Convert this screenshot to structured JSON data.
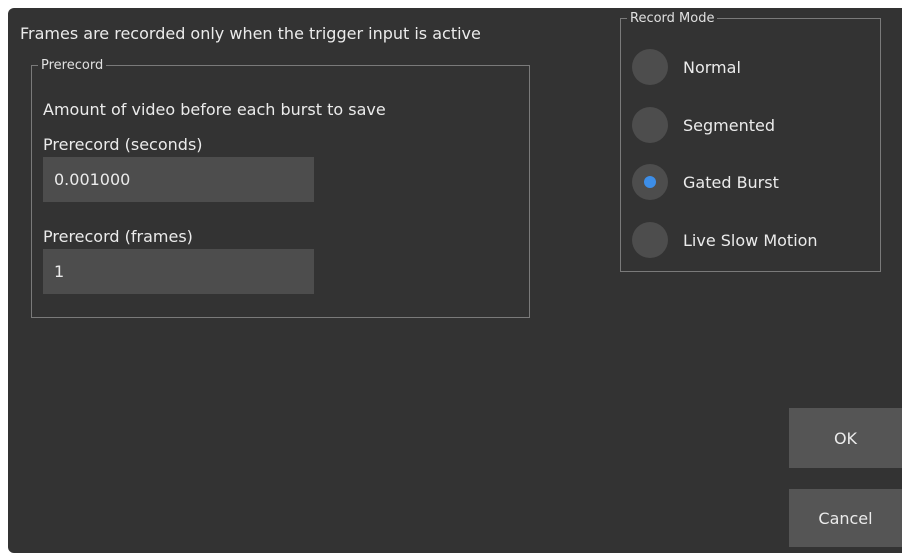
{
  "dialog": {
    "description": "Frames are recorded only when the trigger input is active"
  },
  "prerecord": {
    "group_title": "Prerecord",
    "description": "Amount of video before each burst to save",
    "seconds_label": "Prerecord (seconds)",
    "seconds_value": "0.001000",
    "frames_label": "Prerecord (frames)",
    "frames_value": "1"
  },
  "record_mode": {
    "group_title": "Record Mode",
    "options": [
      {
        "label": "Normal",
        "selected": false
      },
      {
        "label": "Segmented",
        "selected": false
      },
      {
        "label": "Gated Burst",
        "selected": true
      },
      {
        "label": "Live Slow Motion",
        "selected": false
      }
    ]
  },
  "buttons": {
    "ok_label": "OK",
    "cancel_label": "Cancel"
  },
  "colors": {
    "background": "#333333",
    "field": "#4d4d4d",
    "button": "#555555",
    "accent": "#3d8ee8"
  }
}
